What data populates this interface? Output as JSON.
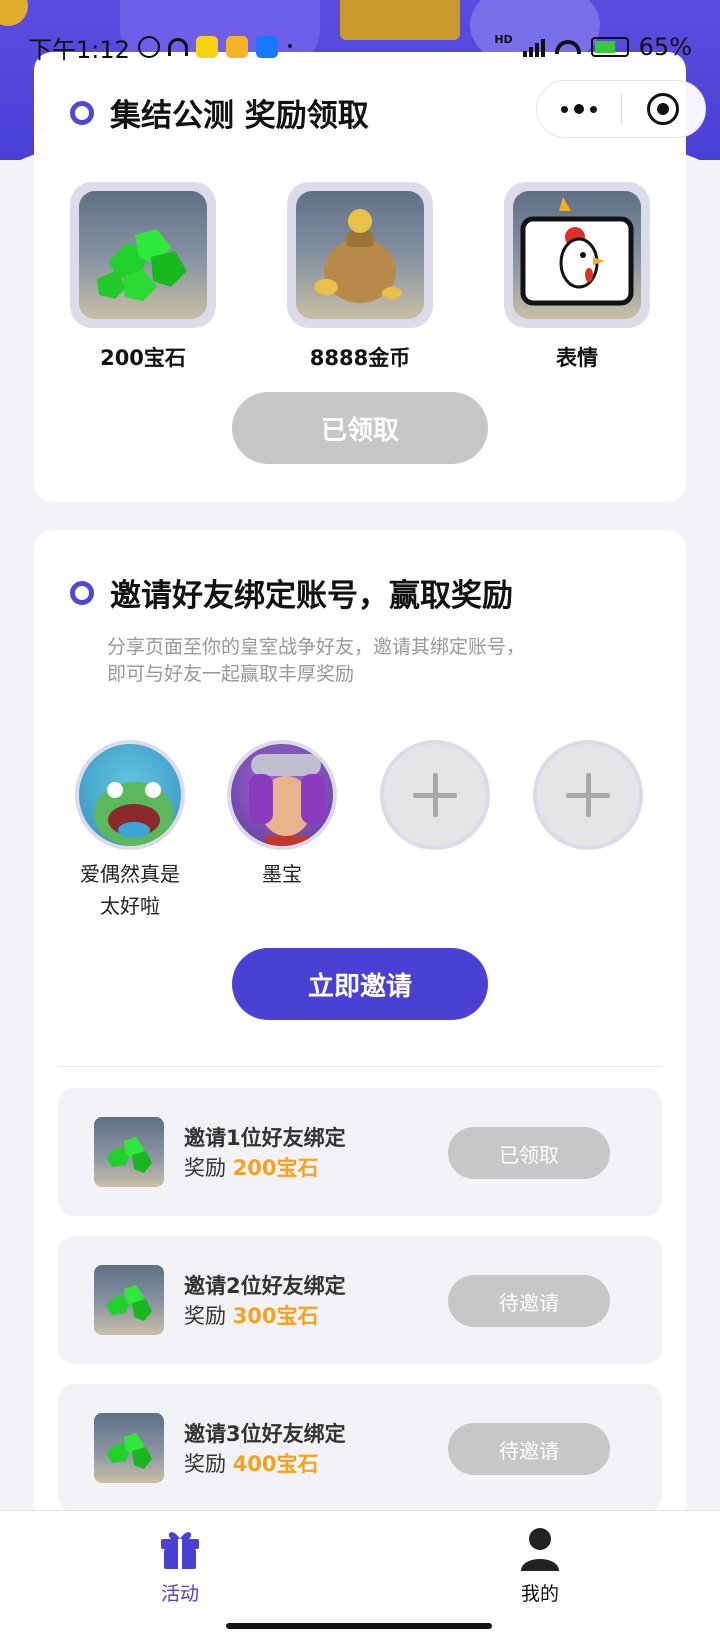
{
  "colors": {
    "accent": "#4a40d4",
    "highlight": "#f7a21b",
    "disabled": "#c7c7c7"
  },
  "status_bar": {
    "time": "下午1:12",
    "network": "HD",
    "battery": "65%"
  },
  "capsule": {
    "more_icon": "more-dots-icon",
    "close_icon": "target-close-icon"
  },
  "section1": {
    "title": "集结公测 奖励领取",
    "rewards": [
      {
        "label": "200宝石",
        "icon": "gems-icon"
      },
      {
        "label": "8888金币",
        "icon": "gold-bag-icon"
      },
      {
        "label": "表情",
        "icon": "chicken-emote-icon"
      }
    ],
    "claim_button": "已领取"
  },
  "section2": {
    "title": "邀请好友绑定账号，赢取奖励",
    "desc_line1": "分享页面至你的皇室战争好友，邀请其绑定账号，",
    "desc_line2": "即可与好友一起赢取丰厚奖励",
    "friends": [
      {
        "name_line1": "爱偶然真是",
        "name_line2": "太好啦"
      },
      {
        "name_line1": "墨宝",
        "name_line2": ""
      }
    ],
    "invite_button": "立即邀请",
    "tasks": [
      {
        "title": "邀请1位好友绑定",
        "prefix": "奖励 ",
        "reward": "200宝石",
        "button": "已领取"
      },
      {
        "title": "邀请2位好友绑定",
        "prefix": "奖励 ",
        "reward": "300宝石",
        "button": "待邀请"
      },
      {
        "title": "邀请3位好友绑定",
        "prefix": "奖励 ",
        "reward": "400宝石",
        "button": "待邀请"
      }
    ]
  },
  "tabbar": {
    "tabs": [
      {
        "label": "活动",
        "icon": "gift-icon",
        "active": true
      },
      {
        "label": "我的",
        "icon": "user-icon",
        "active": false
      }
    ]
  }
}
